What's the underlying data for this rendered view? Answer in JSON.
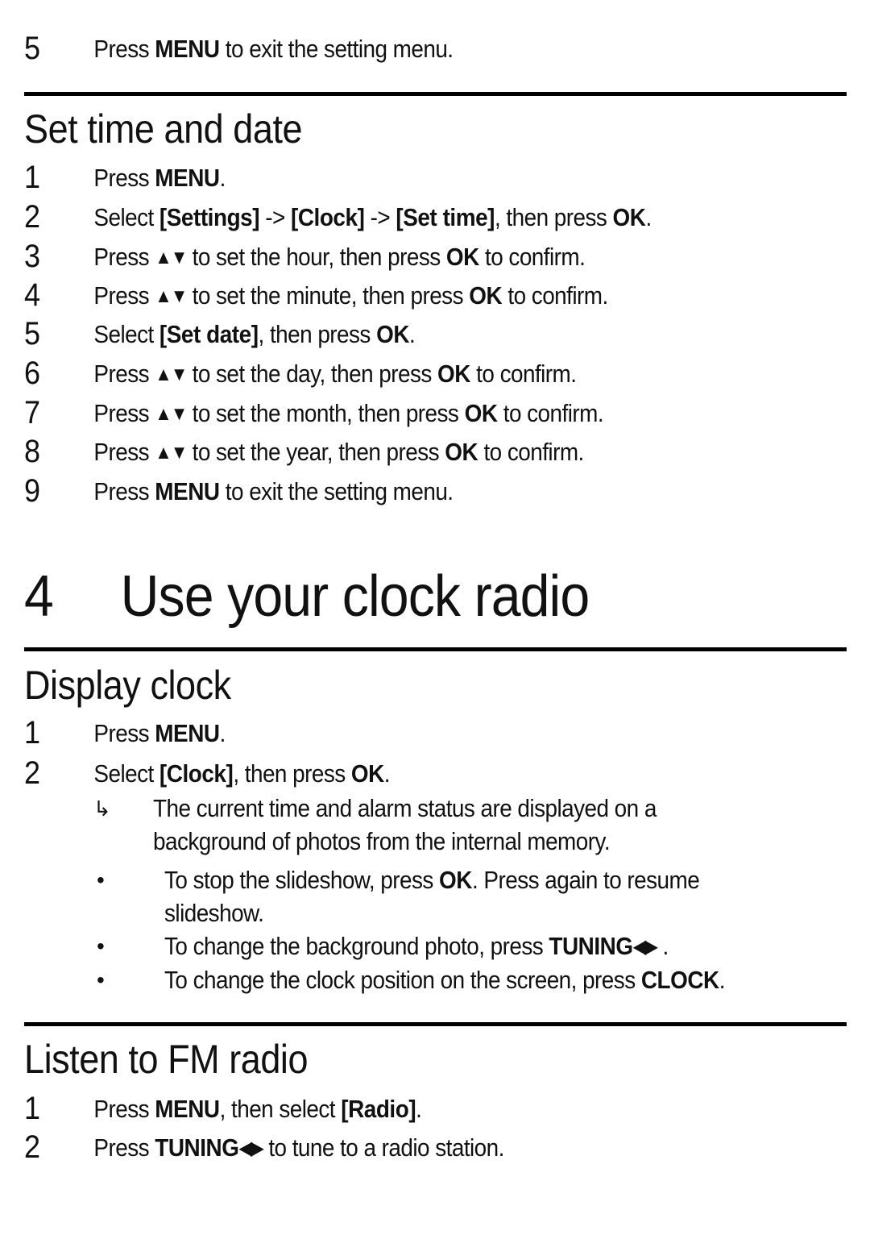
{
  "top_step": {
    "number": "5",
    "segments": [
      {
        "t": "Press "
      },
      {
        "t": "MENU",
        "b": true
      },
      {
        "t": " to exit the setting menu."
      }
    ]
  },
  "set_time": {
    "heading": "Set time and date",
    "steps": [
      {
        "number": "1",
        "segments": [
          {
            "t": "Press "
          },
          {
            "t": "MENU",
            "b": true
          },
          {
            "t": "."
          }
        ]
      },
      {
        "number": "2",
        "segments": [
          {
            "t": "Select "
          },
          {
            "t": "[Settings]",
            "b": true
          },
          {
            "t": " -> "
          },
          {
            "t": "[Clock]",
            "b": true
          },
          {
            "t": " -> "
          },
          {
            "t": "[Set time]",
            "b": true
          },
          {
            "t": ", then press "
          },
          {
            "t": "OK",
            "b": true
          },
          {
            "t": "."
          }
        ]
      },
      {
        "number": "3",
        "segments": [
          {
            "t": "Press "
          },
          {
            "t": "▲▼",
            "icon": "up-down-arrows-icon"
          },
          {
            "t": " to set the hour, then press "
          },
          {
            "t": "OK",
            "b": true
          },
          {
            "t": " to confirm."
          }
        ]
      },
      {
        "number": "4",
        "segments": [
          {
            "t": "Press "
          },
          {
            "t": "▲▼",
            "icon": "up-down-arrows-icon"
          },
          {
            "t": " to set the minute, then press "
          },
          {
            "t": "OK",
            "b": true
          },
          {
            "t": " to confirm."
          }
        ]
      },
      {
        "number": "5",
        "segments": [
          {
            "t": "Select "
          },
          {
            "t": "[Set date]",
            "b": true
          },
          {
            "t": ", then press "
          },
          {
            "t": "OK",
            "b": true
          },
          {
            "t": "."
          }
        ]
      },
      {
        "number": "6",
        "segments": [
          {
            "t": "Press "
          },
          {
            "t": "▲▼",
            "icon": "up-down-arrows-icon"
          },
          {
            "t": " to set the day, then press "
          },
          {
            "t": "OK",
            "b": true
          },
          {
            "t": " to confirm."
          }
        ]
      },
      {
        "number": "7",
        "segments": [
          {
            "t": "Press "
          },
          {
            "t": "▲▼",
            "icon": "up-down-arrows-icon"
          },
          {
            "t": " to set the month, then press "
          },
          {
            "t": "OK",
            "b": true
          },
          {
            "t": " to confirm."
          }
        ]
      },
      {
        "number": "8",
        "segments": [
          {
            "t": "Press "
          },
          {
            "t": "▲▼",
            "icon": "up-down-arrows-icon"
          },
          {
            "t": " to set the year, then press "
          },
          {
            "t": "OK",
            "b": true
          },
          {
            "t": " to confirm."
          }
        ]
      },
      {
        "number": "9",
        "segments": [
          {
            "t": "Press "
          },
          {
            "t": "MENU",
            "b": true
          },
          {
            "t": " to exit the setting menu."
          }
        ]
      }
    ]
  },
  "chapter": {
    "number": "4",
    "title": "Use your clock radio"
  },
  "display_clock": {
    "heading": "Display clock",
    "steps": [
      {
        "number": "1",
        "segments": [
          {
            "t": "Press "
          },
          {
            "t": "MENU",
            "b": true
          },
          {
            "t": "."
          }
        ]
      },
      {
        "number": "2",
        "segments": [
          {
            "t": "Select "
          },
          {
            "t": "[Clock]",
            "b": true
          },
          {
            "t": ", then press "
          },
          {
            "t": "OK",
            "b": true
          },
          {
            "t": "."
          }
        ]
      }
    ],
    "result": {
      "marker": "↳",
      "lines": [
        "The current time and alarm status are displayed on a",
        "background of photos from the internal memory."
      ]
    },
    "bullets": [
      {
        "lines": [
          [
            {
              "t": "To stop the slideshow, press "
            },
            {
              "t": "OK",
              "b": true
            },
            {
              "t": ". Press again to resume"
            }
          ],
          [
            {
              "t": "slideshow."
            }
          ]
        ]
      },
      {
        "lines": [
          [
            {
              "t": "To change the background photo, press "
            },
            {
              "t": "TUNING",
              "b": true
            },
            {
              "t": "◀▶",
              "icon": "left-right-arrows-icon"
            },
            {
              "t": " ."
            }
          ]
        ]
      },
      {
        "lines": [
          [
            {
              "t": "To change the clock position on the screen, press "
            },
            {
              "t": "CLOCK",
              "b": true
            },
            {
              "t": "."
            }
          ]
        ]
      }
    ],
    "bullet_marker": "•"
  },
  "fm_radio": {
    "heading": "Listen to FM radio",
    "steps": [
      {
        "number": "1",
        "segments": [
          {
            "t": "Press "
          },
          {
            "t": "MENU",
            "b": true
          },
          {
            "t": ", then select "
          },
          {
            "t": "[Radio]",
            "b": true
          },
          {
            "t": "."
          }
        ]
      },
      {
        "number": "2",
        "segments": [
          {
            "t": "Press "
          },
          {
            "t": "TUNING",
            "b": true
          },
          {
            "t": "◀▶",
            "icon": "left-right-arrows-icon"
          },
          {
            "t": " to tune to a radio station."
          }
        ]
      }
    ]
  }
}
